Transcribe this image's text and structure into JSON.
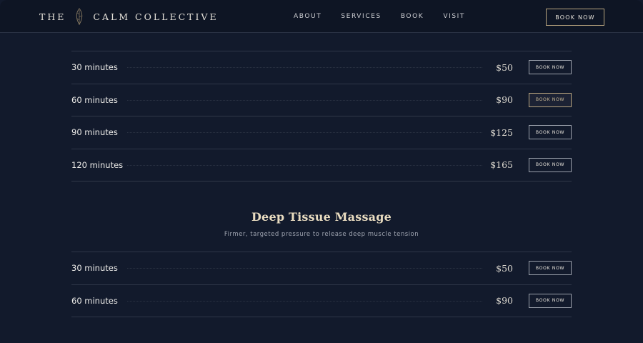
{
  "header": {
    "brand_the": "THE",
    "brand_name": "CALM COLLECTIVE",
    "nav": [
      "ABOUT",
      "SERVICES",
      "BOOK",
      "VISIT"
    ],
    "cta": "BOOK NOW"
  },
  "services": [
    {
      "title": "",
      "subtitle": "",
      "rows": [
        {
          "duration": "30 minutes",
          "price": "$50",
          "button": "BOOK NOW"
        },
        {
          "duration": "60 minutes",
          "price": "$90",
          "button": "BOOK NOW"
        },
        {
          "duration": "90 minutes",
          "price": "$125",
          "button": "BOOK NOW"
        },
        {
          "duration": "120 minutes",
          "price": "$165",
          "button": "BOOK NOW"
        }
      ]
    },
    {
      "title": "Deep Tissue Massage",
      "subtitle": "Firmer, targeted pressure to release deep muscle tension",
      "rows": [
        {
          "duration": "30 minutes",
          "price": "$50",
          "button": "BOOK NOW"
        },
        {
          "duration": "60 minutes",
          "price": "$90",
          "button": "BOOK NOW"
        }
      ]
    }
  ],
  "colors": {
    "background": "#121a2c",
    "header": "#0e1524",
    "accent_gold": "#b9a57f",
    "title": "#e9dcc0"
  }
}
